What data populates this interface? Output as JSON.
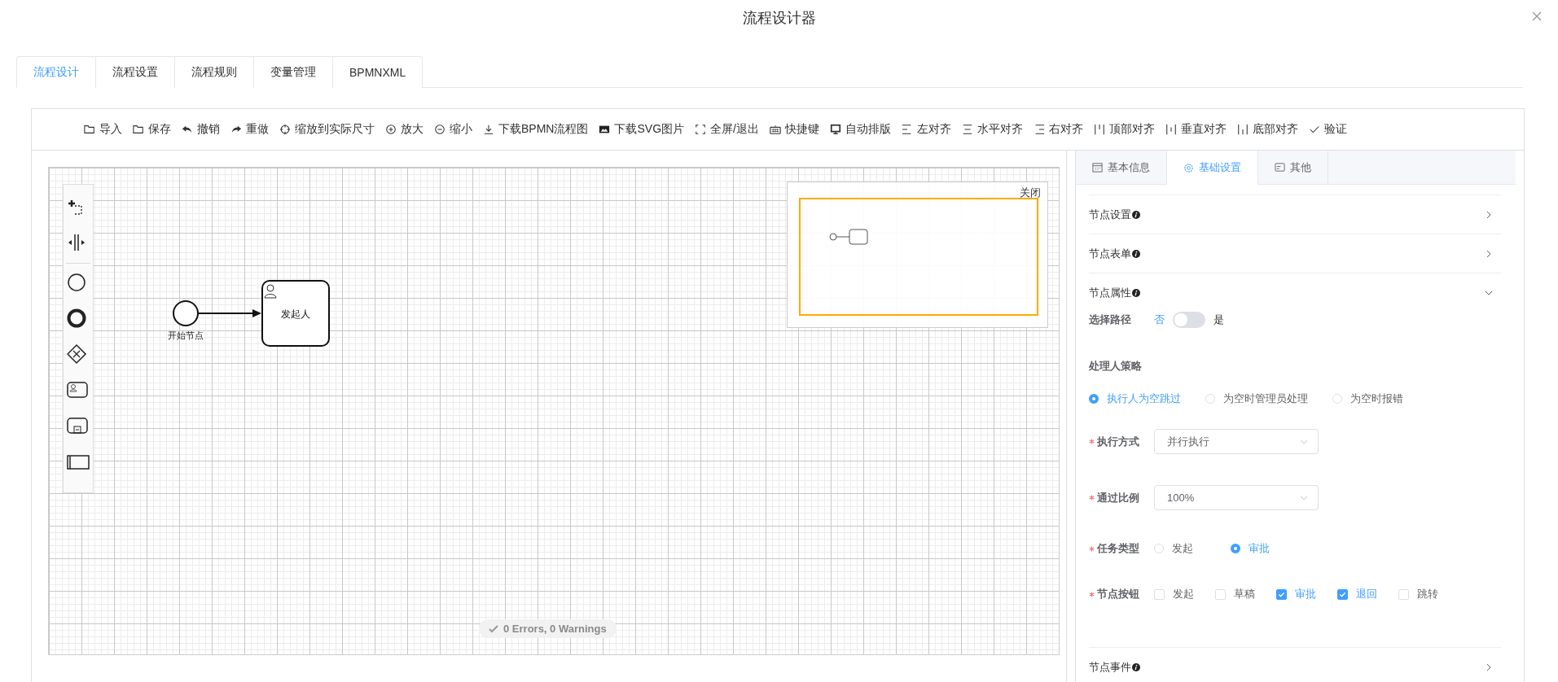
{
  "dialog": {
    "title": "流程设计器"
  },
  "tabs": [
    {
      "label": "流程设计",
      "selected": true
    },
    {
      "label": "流程设置",
      "selected": false
    },
    {
      "label": "流程规则",
      "selected": false
    },
    {
      "label": "变量管理",
      "selected": false
    },
    {
      "label": "BPMNXML",
      "selected": false
    }
  ],
  "toolbar": [
    "导入",
    "保存",
    "撤销",
    "重做",
    "缩放到实际尺寸",
    "放大",
    "缩小",
    "下载BPMN流程图",
    "下载SVG图片",
    "全屏/退出",
    "快捷键",
    "自动排版",
    "左对齐",
    "水平对齐",
    "右对齐",
    "顶部对齐",
    "垂直对齐",
    "底部对齐",
    "验证"
  ],
  "diagram": {
    "start_event": {
      "label": "开始节点"
    },
    "task": {
      "label": "发起人"
    }
  },
  "minimap": {
    "close": "关闭"
  },
  "lint_status": "0 Errors, 0 Warnings",
  "panel": {
    "tabs": [
      {
        "label": "基本信息",
        "selected": false
      },
      {
        "label": "基础设置",
        "selected": true
      },
      {
        "label": "其他",
        "selected": false
      }
    ],
    "sections": [
      {
        "title": "节点设置",
        "expanded": false
      },
      {
        "title": "节点表单",
        "expanded": false
      },
      {
        "title": "节点属性",
        "expanded": true,
        "form": {
          "path_switch": {
            "label": "选择路径",
            "off_label": "否",
            "on_label": "是",
            "on": false
          },
          "strategy": {
            "title": "处理人策略",
            "options": [
              {
                "label": "执行人为空跳过",
                "selected": true
              },
              {
                "label": "为空时管理员处理",
                "selected": false
              },
              {
                "label": "为空时报错",
                "selected": false
              }
            ]
          },
          "fields": [
            {
              "kind": "select",
              "label": "执行方式",
              "required": true,
              "value": "并行执行"
            },
            {
              "kind": "select",
              "label": "通过比例",
              "required": true,
              "value": "100%"
            },
            {
              "kind": "radio",
              "label": "任务类型",
              "required": true,
              "options": [
                {
                  "label": "发起",
                  "selected": false
                },
                {
                  "label": "审批",
                  "selected": true
                }
              ]
            },
            {
              "kind": "checkbox",
              "label": "节点按钮",
              "required": true,
              "options": [
                {
                  "label": "发起",
                  "checked": false
                },
                {
                  "label": "草稿",
                  "checked": false
                },
                {
                  "label": "审批",
                  "checked": true
                },
                {
                  "label": "退回",
                  "checked": true
                },
                {
                  "label": "跳转",
                  "checked": false
                }
              ]
            }
          ]
        }
      },
      {
        "title": "节点事件",
        "expanded": false
      }
    ]
  }
}
